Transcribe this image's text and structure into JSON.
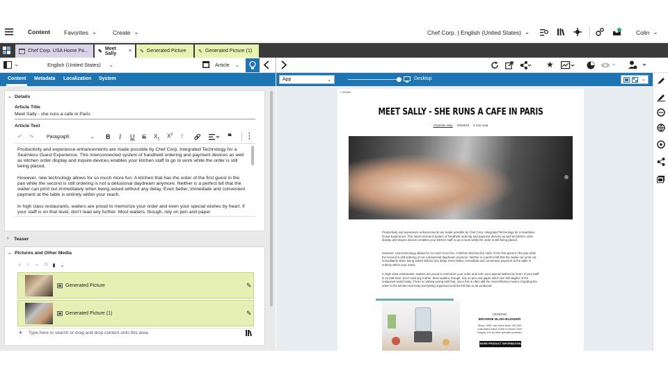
{
  "header": {
    "app": "Content",
    "favorites": "Favorites",
    "create": "Create",
    "site": "Chef Corp. | English (United States)",
    "notify_count": "1",
    "user": "Colin"
  },
  "tabs": [
    {
      "label": "Chef Corp. USA Home Pa..."
    },
    {
      "label": "Meet Sally"
    },
    {
      "label": "Generated Picture"
    },
    {
      "label": "Generated Picture (1)"
    }
  ],
  "toolbar": {
    "locale": "English (United States)",
    "type": "Article"
  },
  "subtabs": [
    "Content",
    "Metadata",
    "Localization",
    "System"
  ],
  "details": {
    "section": "Details",
    "title_label": "Article Title",
    "title_value": "Meet Sally - she runs a cafe in Paris",
    "text_label": "Article Text",
    "paragraph_select": "Paragraph",
    "paragraphs": [
      "Productivity and experience enhancements are made possible by Chef Corp. Integrated Technology for a Seamless Guest Experience. This interconnected system of handheld ordering and payment devices as well as kitchen order display and inquire devices enables your kitchen staff to go to work while the order is still being placed.",
      "However, new technology allows for so much more fun. A kitchen that has the order of the first guest in the pan while the second is still ordering is not a delusional daydream anymore. Neither is a perfect bill that the waiter can print out immediately when being asked without any delay. Even better, immediate and convenient payment at the table is entirely within your reach.",
      "In high class restaurants, waiters are proud to memorize your order and even your special wishes by heart. If your staff is on that level, don't read any further. Most waiters, though, rely on pen and paper"
    ]
  },
  "teaser": {
    "label": "Teaser"
  },
  "media": {
    "section": "Pictures and Other Media",
    "items": [
      {
        "label": "Generated Picture"
      },
      {
        "label": "Generated Picture (1)"
      }
    ],
    "placeholder": "Type here to search or drag and drop content onto this area."
  },
  "preview_bar": {
    "app_select": "App",
    "device": "Desktop"
  },
  "preview": {
    "breadcrumb": "< Default",
    "headline": "MEET SALLY - SHE RUNS A CAFE IN PARIS",
    "author": "Charlotte May",
    "date": "2/9/2023",
    "read_time": "4 min read",
    "paragraphs": [
      "Productivity and experience enhancements are made possible by Chef Corp. Integrated Technology for a Seamless Guest Experience. This interconnected system of handheld ordering and payment devices as well as kitchen order display and inquire devices enables your kitchen staff to go to work while the order is still being placed.",
      "However, new technology allows for so much more fun. A kitchen that has the order of the first guest in the pan while the second is still ordering is not a delusional daydream anymore. Neither is a perfect bill that the waiter can print out immediately when being asked without any delay. Even better, immediate and convenient payment at the table is entirely within your reach.",
      "In high class restaurants, waiters are proud to memorize your order and even your special wishes by heart. If your staff is on that level, don't read any further. Most waiters, though, rely on pen and paper which are still staples of the restaurant world today. There is nothing wrong with that, since this is often still the most effective means of getting the order to the kitchen and keep everything organized until the bill has to be produced."
    ],
    "promo_date": "10/20/2022",
    "promo_title": "BROWNIE BL300 BLENDER",
    "promo_text": "Since 1999, our more than 125,000 customers have come to know Chef Supply, Inc as their premier provider",
    "promo_button": "MORE PRODUCT INFORMATION"
  },
  "colors": {
    "accent": "#1e75b3",
    "tab_lilac": "#d9d2e9",
    "tab_green": "#e8f2b0",
    "media_row": "#e6f0b4"
  }
}
